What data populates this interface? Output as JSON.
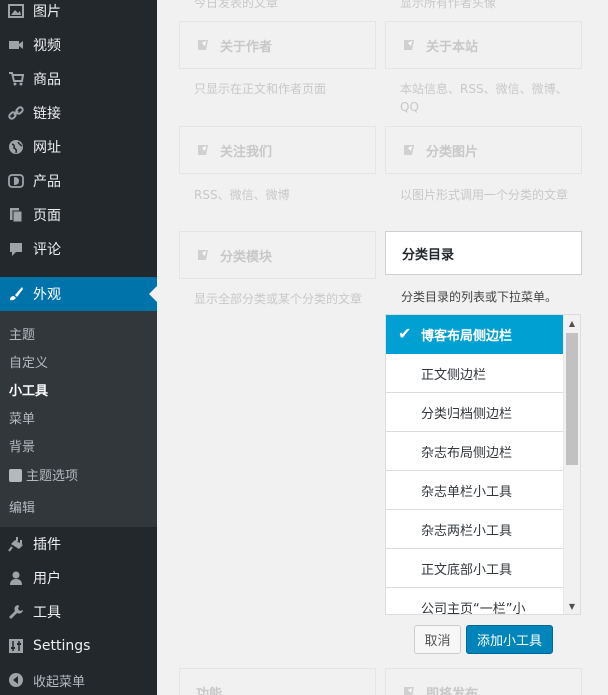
{
  "sidebar": {
    "items": [
      {
        "label": "图片",
        "icon": "image-icon"
      },
      {
        "label": "视频",
        "icon": "video-icon"
      },
      {
        "label": "商品",
        "icon": "cart-icon"
      },
      {
        "label": "链接",
        "icon": "link-icon"
      },
      {
        "label": "网址",
        "icon": "globe-icon"
      },
      {
        "label": "产品",
        "icon": "product-icon"
      },
      {
        "label": "页面",
        "icon": "pages-icon"
      },
      {
        "label": "评论",
        "icon": "comment-icon"
      },
      {
        "label": "外观",
        "icon": "brush-icon"
      },
      {
        "label": "插件",
        "icon": "plugin-icon"
      },
      {
        "label": "用户",
        "icon": "user-icon"
      },
      {
        "label": "工具",
        "icon": "wrench-icon"
      },
      {
        "label": "Settings",
        "icon": "settings-icon"
      },
      {
        "label": "收起菜单",
        "icon": "collapse-icon"
      }
    ],
    "submenu": [
      "主题",
      "自定义",
      "小工具",
      "菜单",
      "背景",
      "主题选项",
      "编辑"
    ],
    "active_color": "#0073aa"
  },
  "widgets": {
    "top_desc_1": "今日发表的文章",
    "top_desc_2": "显示所有作者头像",
    "author_title": "关于作者",
    "author_desc": "只显示在正文和作者页面",
    "site_title": "关于本站",
    "site_desc": "本站信息、RSS、微信、微博、QQ",
    "follow_title": "关注我们",
    "follow_desc": "RSS、微信、微博",
    "catimg_title": "分类图片",
    "catimg_desc": "以图片形式调用一个分类的文章",
    "catmod_title": "分类模块",
    "catmod_desc": "显示全部分类或某个分类的文章",
    "bottom_left_title": "功能",
    "bottom_right_title": "即将发布"
  },
  "expanded": {
    "title": "分类目录",
    "desc": "分类目录的列表或下拉菜单。",
    "options": [
      "博客布局侧边栏",
      "正文侧边栏",
      "分类归档侧边栏",
      "杂志布局侧边栏",
      "杂志单栏小工具",
      "杂志两栏小工具",
      "正文底部小工具",
      "公司主页“一栏”小"
    ],
    "selected_color": "#00a0d2",
    "cancel_label": "取消",
    "add_label": "添加小工具"
  }
}
